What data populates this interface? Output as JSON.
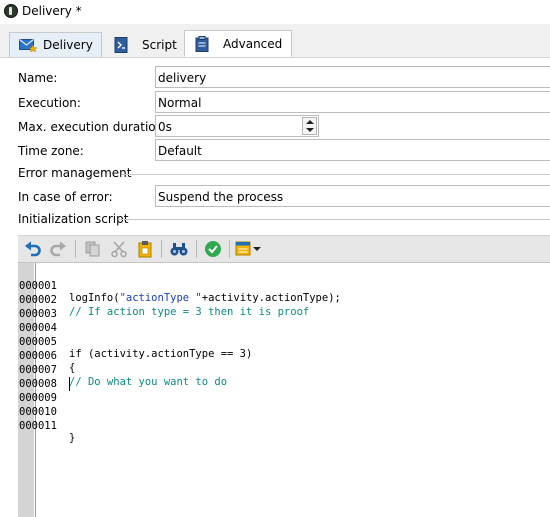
{
  "window": {
    "title": "Delivery *"
  },
  "tabs": [
    {
      "label": "Delivery",
      "icon": "mail-star-icon"
    },
    {
      "label": "Script",
      "icon": "script-icon"
    },
    {
      "label": "Advanced",
      "icon": "clipboard-icon",
      "active": true
    }
  ],
  "form": {
    "name_label": "Name:",
    "name_value": "delivery",
    "execution_label": "Execution:",
    "execution_value": "Normal",
    "max_duration_label": "Max. execution duration:",
    "max_duration_value": "0s",
    "timezone_label": "Time zone:",
    "timezone_value": "Default",
    "error_section": "Error management",
    "in_case_label": "In case of error:",
    "in_case_value": "Suspend the process",
    "init_section": "Initialization script"
  },
  "toolbar": [
    "undo-icon",
    "redo-icon",
    "copy-icon",
    "cut-icon",
    "paste-icon",
    "find-icon",
    "validate-icon",
    "insert-menu-icon"
  ],
  "colors": {
    "accent": "#1f6fb5",
    "comment": "#0b8b80",
    "string": "#1a3fbf",
    "validate": "#2fa84f",
    "paste": "#e8a500"
  },
  "code": {
    "line_numbers": [
      "000001",
      "000002",
      "000003",
      "000004",
      "000005",
      "000006",
      "000007",
      "000008",
      "000009",
      "000010",
      "000011"
    ],
    "l1_a": "logInfo(",
    "l1_b": "\"actionType \"",
    "l1_c": "+activity.actionType);",
    "l2": "// If action type = 3 then it is proof",
    "l5": "if (activity.actionType == 3)",
    "l6": "{",
    "l7": "// Do what you want to do",
    "l11": "}"
  }
}
